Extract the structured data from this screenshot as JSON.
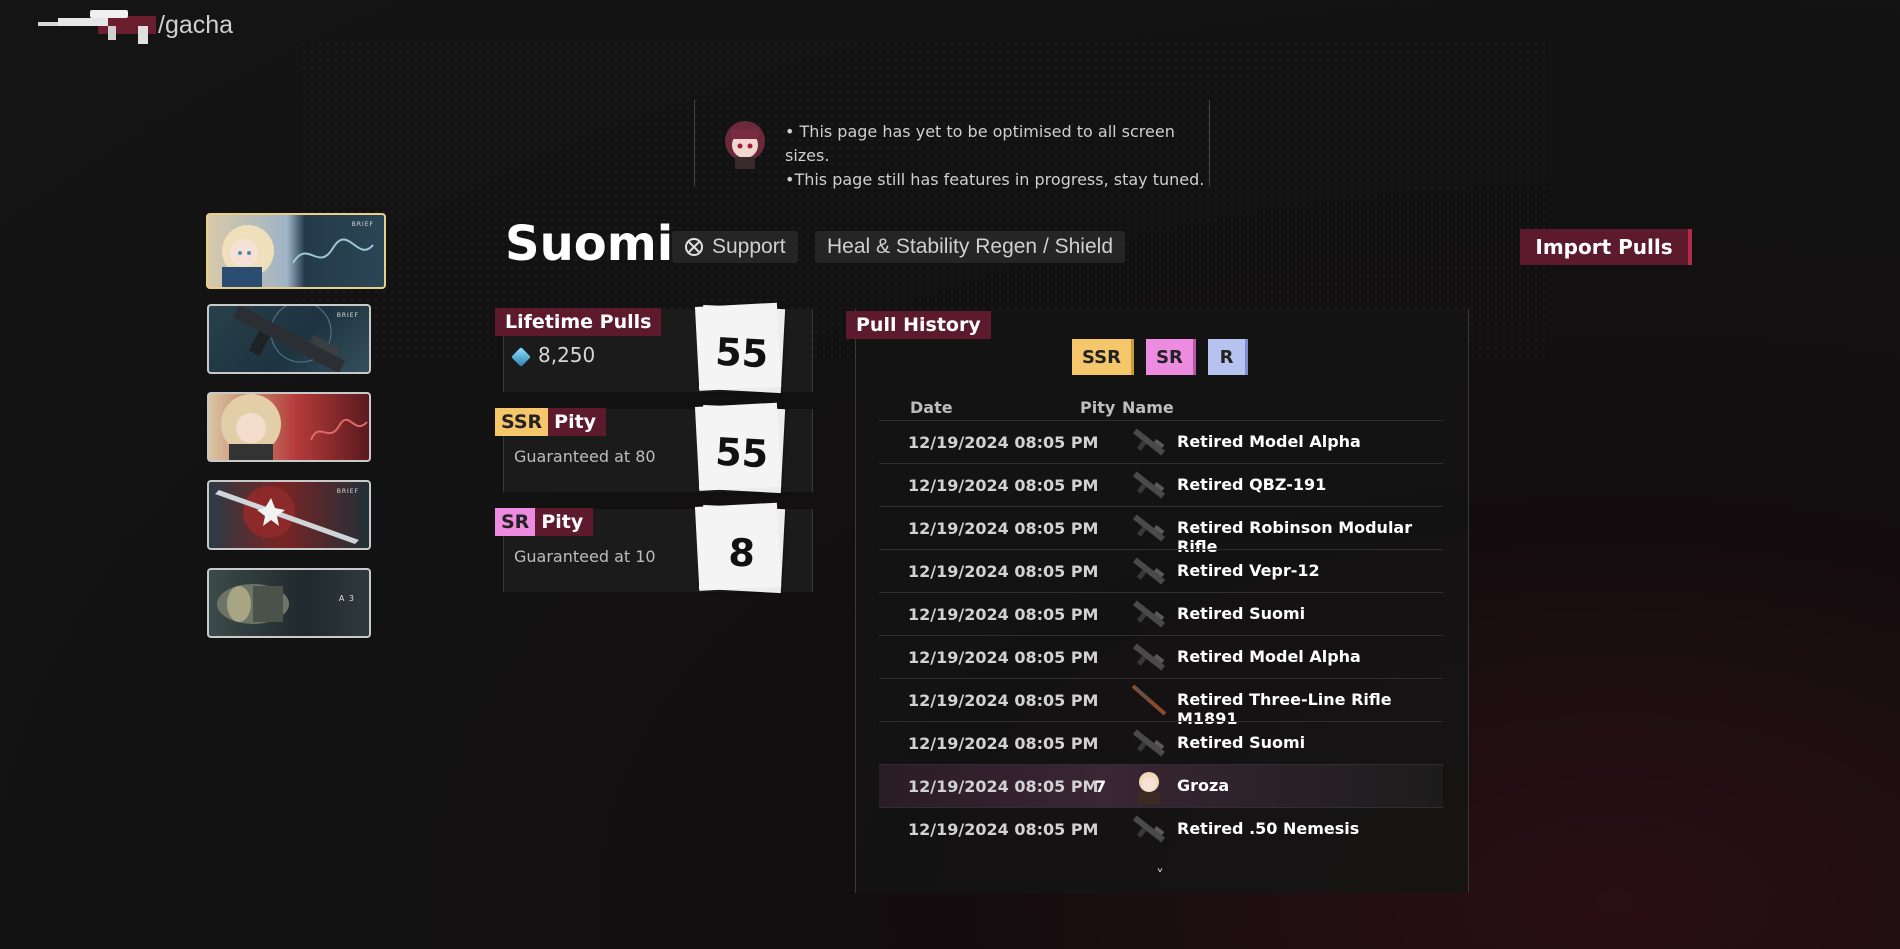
{
  "header": {
    "route": "/gacha",
    "logo_icon": "rifle-logo-icon"
  },
  "notice": {
    "line1": "• This page has yet to be optimised to all screen sizes.",
    "line2": "•This page still has features in progress, stay tuned."
  },
  "banners": [
    {
      "name": "Suomi banner",
      "tag": "BRIEF",
      "active": true
    },
    {
      "name": "weapon banner",
      "tag": "BRIEF"
    },
    {
      "name": "character banner",
      "tag": "BRIEF"
    },
    {
      "name": "weapon banner 2",
      "tag": "BRIEF"
    },
    {
      "name": "standard banner",
      "tag": "A 3"
    }
  ],
  "character": {
    "name": "Suomi",
    "class_icon": "support-class-icon",
    "class": "Support",
    "role": "Heal & Stability Regen / Shield"
  },
  "import_label": "Import Pulls",
  "stats": {
    "lifetime": {
      "label": "Lifetime Pulls",
      "currency_icon": "gem-icon",
      "currency": "8,250",
      "count": "55"
    },
    "ssr": {
      "badge": "SSR",
      "label": "Pity",
      "sub": "Guaranteed at 80",
      "count": "55"
    },
    "sr": {
      "badge": "SR",
      "label": "Pity",
      "sub": "Guaranteed at 10",
      "count": "8"
    }
  },
  "history": {
    "label": "Pull History",
    "filters": {
      "ssr": "SSR",
      "sr": "SR",
      "r": "R"
    },
    "columns": {
      "date": "Date",
      "pity": "Pity",
      "name": "Name"
    },
    "rows": [
      {
        "date": "12/19/2024 08:05 PM",
        "pity": "",
        "name": "Retired Model Alpha",
        "icon": "rifle-icon"
      },
      {
        "date": "12/19/2024 08:05 PM",
        "pity": "",
        "name": "Retired QBZ-191",
        "icon": "rifle-icon"
      },
      {
        "date": "12/19/2024 08:05 PM",
        "pity": "",
        "name": "Retired Robinson Modular Rifle",
        "icon": "rifle-icon"
      },
      {
        "date": "12/19/2024 08:05 PM",
        "pity": "",
        "name": "Retired Vepr-12",
        "icon": "shotgun-icon"
      },
      {
        "date": "12/19/2024 08:05 PM",
        "pity": "",
        "name": "Retired Suomi",
        "icon": "smg-icon"
      },
      {
        "date": "12/19/2024 08:05 PM",
        "pity": "",
        "name": "Retired Model Alpha",
        "icon": "rifle-icon"
      },
      {
        "date": "12/19/2024 08:05 PM",
        "pity": "",
        "name": "Retired Three-Line Rifle M1891",
        "icon": "bolt-rifle-icon"
      },
      {
        "date": "12/19/2024 08:05 PM",
        "pity": "",
        "name": "Retired Suomi",
        "icon": "smg-icon"
      },
      {
        "date": "12/19/2024 08:05 PM",
        "pity": "7",
        "name": "Groza",
        "icon": "character-portrait-icon",
        "highlight": true
      },
      {
        "date": "12/19/2024 08:05 PM",
        "pity": "",
        "name": "Retired .50 Nemesis",
        "icon": "sniper-icon"
      }
    ],
    "more": "˅"
  }
}
